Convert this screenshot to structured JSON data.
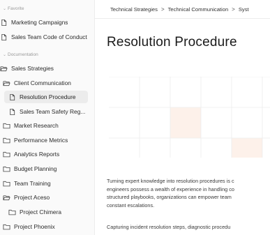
{
  "sidebar": {
    "sections": [
      {
        "label": "Favorite",
        "items": [
          {
            "label": "Marketing Campaigns",
            "icon": "file-icon"
          },
          {
            "label": "Sales Team Code of Conduct",
            "icon": "file-icon"
          }
        ]
      },
      {
        "label": "Documentation",
        "items": [
          {
            "label": "Sales Strategies",
            "icon": "folder-open-icon"
          },
          {
            "label": "Client Communication",
            "icon": "folder-open-icon"
          },
          {
            "label": "Resolution Procedure",
            "icon": "file-icon",
            "active": true
          },
          {
            "label": "Sales Team Safety Reg...",
            "icon": "file-icon"
          },
          {
            "label": "Market Research",
            "icon": "folder-icon"
          },
          {
            "label": "Performance Metrics",
            "icon": "folder-icon"
          },
          {
            "label": "Analytics Reports",
            "icon": "folder-icon"
          },
          {
            "label": "Budget Planning",
            "icon": "folder-icon"
          },
          {
            "label": "Team Training",
            "icon": "folder-icon"
          },
          {
            "label": "Project Aceso",
            "icon": "folder-open-icon"
          },
          {
            "label": "Project Chimera",
            "icon": "folder-icon"
          },
          {
            "label": "Project Phoenix",
            "icon": "folder-icon"
          }
        ]
      }
    ]
  },
  "breadcrumb": {
    "items": [
      "Technical Strategies",
      "Technical Communication",
      "Syst"
    ],
    "separator": ">"
  },
  "page": {
    "title": "Resolution Procedure",
    "paragraphs": [
      {
        "lines": [
          "Turning expert knowledge into resolution procedures is c",
          "engineers possess a wealth of experience in handling co",
          "structured playbooks, organizations can empower team",
          "constant escalations."
        ]
      },
      {
        "lines": [
          "Capturing incident resolution steps, diagnostic procedu"
        ]
      }
    ]
  },
  "colors": {
    "grid_highlight": "#fdf1ea",
    "grid_line": "#ececec",
    "active_item_bg": "#ececec"
  }
}
